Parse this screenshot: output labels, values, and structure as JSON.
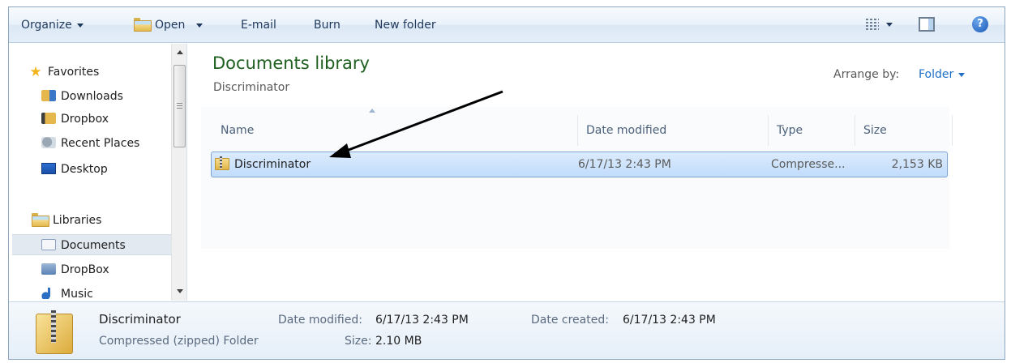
{
  "toolbar": {
    "organize": "Organize",
    "open": "Open",
    "email": "E-mail",
    "burn": "Burn",
    "new_folder": "New folder",
    "icons": {
      "views": "views-icon",
      "preview_pane": "preview-pane-icon",
      "help": "help-icon"
    },
    "help_glyph": "?"
  },
  "nav": {
    "favorites_label": "Favorites",
    "favorites": [
      "Downloads",
      "Dropbox",
      "Recent Places",
      "Desktop"
    ],
    "libraries_label": "Libraries",
    "libraries": [
      "Documents",
      "DropBox",
      "Music"
    ],
    "selected": "Documents"
  },
  "content": {
    "title": "Documents library",
    "subtitle": "Discriminator",
    "arrange_label": "Arrange by:",
    "arrange_value": "Folder",
    "columns": [
      "Name",
      "Date modified",
      "Type",
      "Size"
    ],
    "rows": [
      {
        "name": "Discriminator",
        "date_modified": "6/17/13 2:43 PM",
        "type": "Compresse...",
        "size": "2,153 KB"
      }
    ]
  },
  "details": {
    "name": "Discriminator",
    "kind": "Compressed (zipped) Folder",
    "date_modified_label": "Date modified:",
    "date_modified": "6/17/13 2:43 PM",
    "size_label": "Size:",
    "size": "2.10 MB",
    "date_created_label": "Date created:",
    "date_created": "6/17/13 2:43 PM"
  },
  "colors": {
    "title_green": "#1e5e1e",
    "link_blue": "#1f6fc6",
    "selection": "#c1dcfc",
    "annotation_arrow": "#000000"
  }
}
